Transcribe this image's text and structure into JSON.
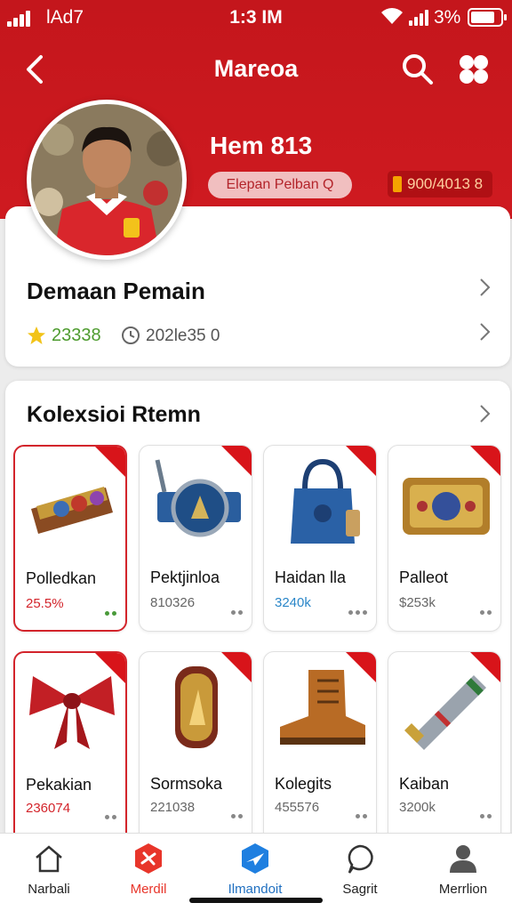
{
  "status_bar": {
    "carrier": "lAd7",
    "time": "1:3 IM",
    "battery": "3%",
    "battery_level": 0.8
  },
  "header": {
    "title": "Mareoa"
  },
  "profile": {
    "name": "Hem 813",
    "position_badge": "Elepan Pelban Q",
    "value_badge": "900/4013 8"
  },
  "info": {
    "title": "Demaan Pemain",
    "stat_rating": "23338",
    "stat_time": "202le35 0"
  },
  "collection": {
    "title": "Kolexsioi Rtemn",
    "items": [
      {
        "name": "Polledkan",
        "price": "25.5%",
        "price_color": "#d3242b",
        "selected": true,
        "icon": "belt-pouch-icon"
      },
      {
        "name": "Pektjinloa",
        "price": "810326",
        "price_color": "#666666",
        "selected": false,
        "icon": "watch-icon"
      },
      {
        "name": "Haidan lla",
        "price": "3240k",
        "price_color": "#2a86c8",
        "selected": false,
        "icon": "handbag-icon"
      },
      {
        "name": "Palleot",
        "price": "$253k",
        "price_color": "#666666",
        "selected": false,
        "icon": "wallet-icon"
      },
      {
        "name": "Pekakian",
        "price": "236074",
        "price_color": "#d3242b",
        "selected": true,
        "icon": "bow-icon"
      },
      {
        "name": "Sormsoka",
        "price": "221038",
        "price_color": "#666666",
        "selected": false,
        "icon": "medal-icon"
      },
      {
        "name": "Kolegits",
        "price": "455576",
        "price_color": "#666666",
        "selected": false,
        "icon": "boot-icon"
      },
      {
        "name": "Kaiban",
        "price": "3200k",
        "price_color": "#666666",
        "selected": false,
        "icon": "scroll-icon"
      }
    ]
  },
  "nav": {
    "tabs": [
      {
        "label": "Narbali",
        "icon": "home-icon",
        "active": false
      },
      {
        "label": "Merdil",
        "icon": "cross-icon",
        "active": true
      },
      {
        "label": "Ilmandoit",
        "icon": "send-icon",
        "active": false
      },
      {
        "label": "Sagrit",
        "icon": "chat-icon",
        "active": false
      },
      {
        "label": "Merrlion",
        "icon": "person-icon",
        "active": false
      }
    ]
  },
  "colors": {
    "brand_red": "#c4161c",
    "rating_green": "#4d9b2e",
    "active_tab": "#e8352a",
    "blue_tab": "#1f7fe0"
  }
}
